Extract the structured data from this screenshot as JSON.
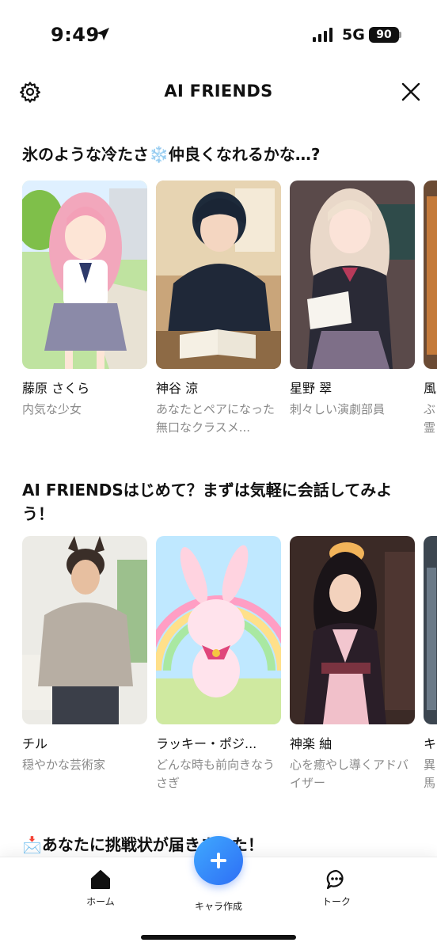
{
  "status_bar": {
    "time": "9:49",
    "network": "5G",
    "battery": "90"
  },
  "header": {
    "title": "AI FRIENDS"
  },
  "sections": [
    {
      "title": "氷のような冷たさ❄️仲良くなれるかな…?",
      "cards": [
        {
          "name": "藤原 さくら",
          "desc": "内気な少女"
        },
        {
          "name": "神谷 涼",
          "desc": "あなたとペアになった無口なクラスメ..."
        },
        {
          "name": "星野 翠",
          "desc": "刺々しい演劇部員"
        },
        {
          "name": "風",
          "desc": "ぶ 霊"
        }
      ]
    },
    {
      "title": "AI FRIENDSはじめて？まずは気軽に会話してみよう！",
      "cards": [
        {
          "name": "チル",
          "desc": "穏やかな芸術家"
        },
        {
          "name": "ラッキー・ポジ...",
          "desc": "どんな時も前向きなうさぎ"
        },
        {
          "name": "神楽 紬",
          "desc": "心を癒やし導くアドバイザー"
        },
        {
          "name": "キ",
          "desc": "異 馬"
        }
      ]
    },
    {
      "title": "📩あなたに挑戦状が届きました！"
    }
  ],
  "nav": {
    "home": "ホーム",
    "create": "キャラ作成",
    "talk": "トーク"
  },
  "colors": {
    "accent": "#2e6ef5",
    "text_secondary": "#8a8a8a"
  }
}
